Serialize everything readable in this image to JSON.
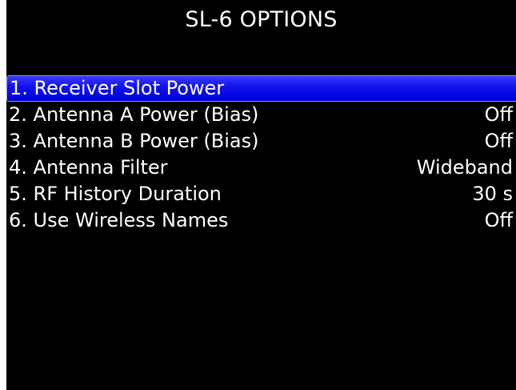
{
  "screen": {
    "title": "SL-6 OPTIONS",
    "highlight_color": "#0a0aee",
    "text_color": "#ffffff",
    "background_color": "#000000"
  },
  "menu": {
    "selected_index": 0,
    "items": [
      {
        "label": "1. Receiver Slot Power",
        "value": ""
      },
      {
        "label": "2. Antenna A Power (Bias)",
        "value": "Off"
      },
      {
        "label": "3. Antenna B Power (Bias)",
        "value": "Off"
      },
      {
        "label": "4. Antenna Filter",
        "value": "Wideband"
      },
      {
        "label": "5. RF History Duration",
        "value": "30 s"
      },
      {
        "label": "6. Use Wireless Names",
        "value": "Off"
      }
    ]
  }
}
